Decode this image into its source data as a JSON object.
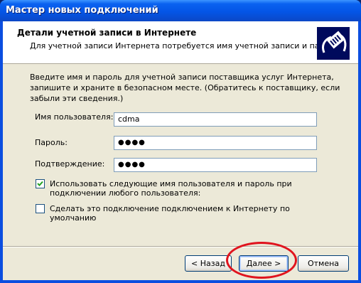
{
  "window": {
    "title": "Мастер новых подключений"
  },
  "header": {
    "title": "Детали учетной записи в Интернете",
    "subtitle": "Для учетной записи Интернета потребуется имя учетной записи и пароль."
  },
  "intro": "Введите имя и пароль для учетной записи поставщика услуг Интернета, запишите и храните в безопасном месте. (Обратитесь к поставщику, если забыли эти сведения.)",
  "fields": {
    "username": {
      "label": "Имя пользователя:",
      "value": "cdma"
    },
    "password": {
      "label": "Пароль:",
      "value": "●●●●"
    },
    "confirm": {
      "label": "Подтверждение:",
      "value": "●●●●"
    }
  },
  "checkboxes": {
    "use_for_all": {
      "label": "Использовать следующие имя пользователя и пароль при подключении любого пользователя:",
      "checked": true
    },
    "default_connection": {
      "label": "Сделать это подключение подключением к Интернету по умолчанию",
      "checked": false
    }
  },
  "buttons": {
    "back": "< Назад",
    "next": "Далее >",
    "cancel": "Отмена"
  },
  "highlight": {
    "color": "#e0141e"
  },
  "icons": {
    "header": "network-cable-icon",
    "check": "checkmark-icon"
  }
}
